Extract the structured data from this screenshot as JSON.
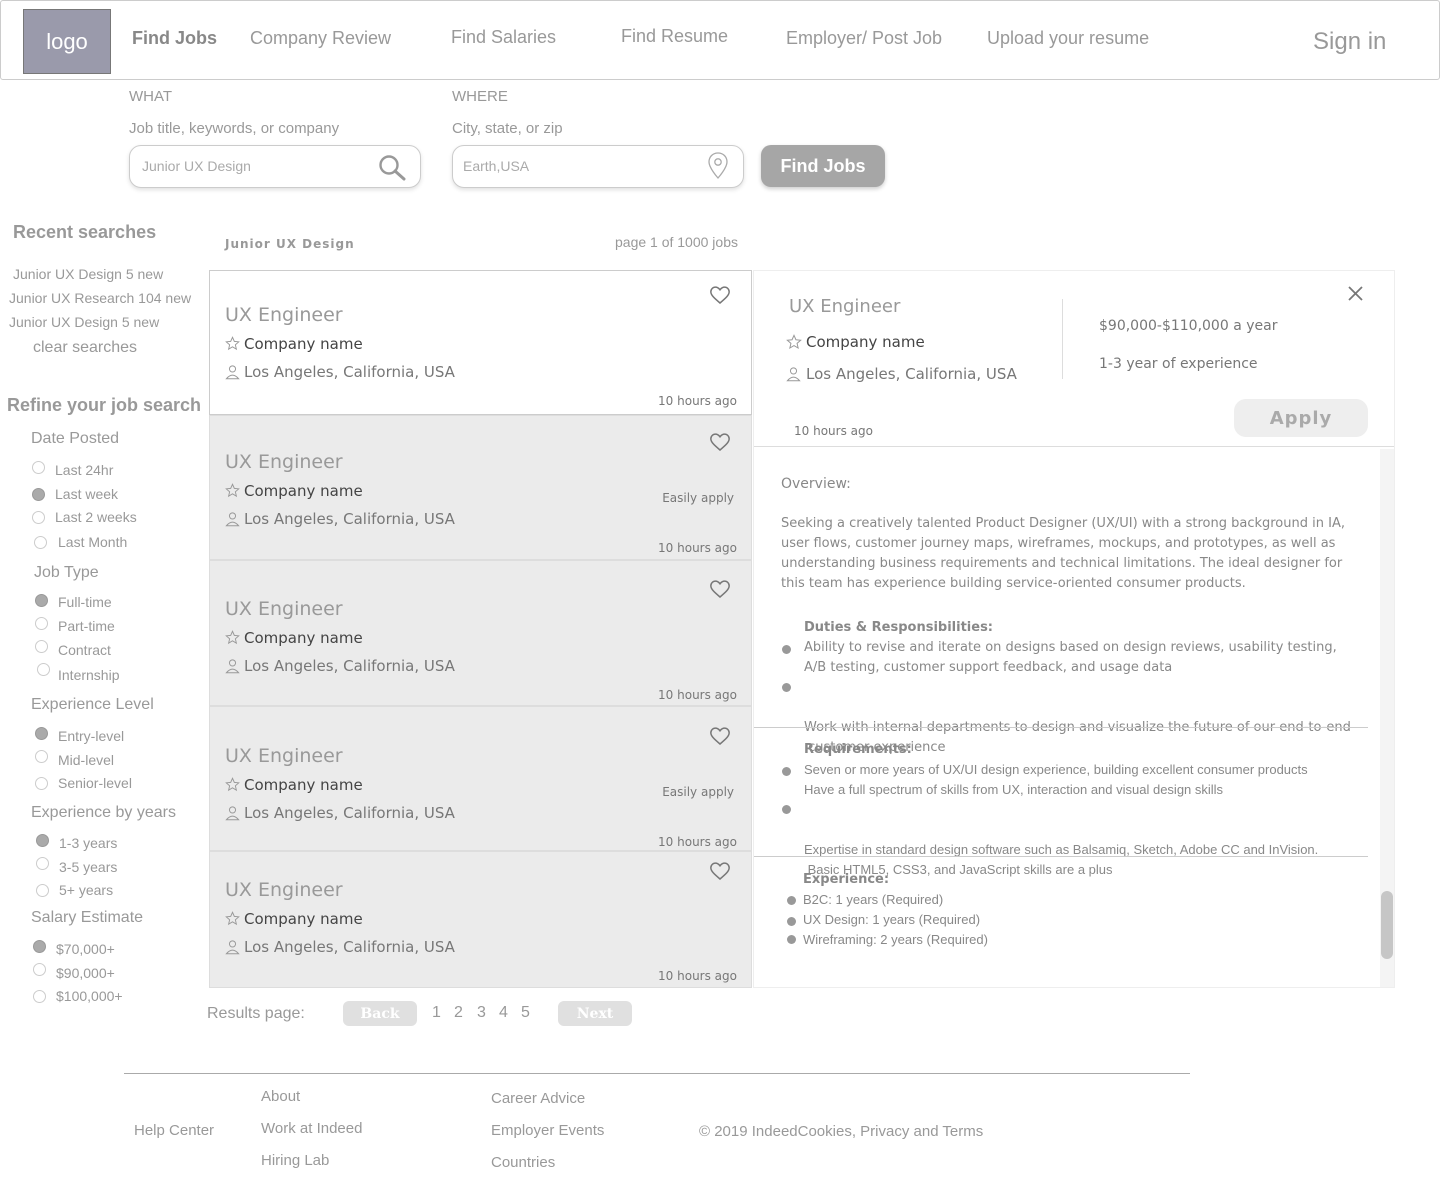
{
  "header": {
    "logo": "logo",
    "nav": [
      "Find Jobs",
      "Company Review",
      "Find Salaries",
      "Find Resume",
      "Employer/ Post Job",
      "Upload your resume"
    ],
    "signin": "Sign in"
  },
  "search": {
    "what_label": "WHAT",
    "what_hint": "Job title, keywords, or company",
    "what_placeholder": "Junior UX Design",
    "where_label": "WHERE",
    "where_hint": "City, state, or zip",
    "where_placeholder": "Earth,USA",
    "button": "Find Jobs"
  },
  "recent": {
    "title": "Recent searches",
    "items": [
      "Junior UX Design  5 new",
      "Junior UX Research 104 new",
      "Junior UX Design  5 new"
    ],
    "clear": "clear searches"
  },
  "refine": {
    "title": "Refine your job search",
    "groups": [
      {
        "label": "Date Posted",
        "options": [
          "Last 24hr",
          "Last week",
          "Last 2 weeks",
          "Last Month"
        ]
      },
      {
        "label": "Job Type",
        "options": [
          "Full-time",
          "Part-time",
          "Contract",
          "Internship"
        ]
      },
      {
        "label": "Experience Level",
        "options": [
          "Entry-level",
          "Mid-level",
          "Senior-level"
        ]
      },
      {
        "label": "Experience by years",
        "options": [
          "1-3 years",
          "3-5 years",
          "5+ years"
        ]
      },
      {
        "label": "Salary Estimate",
        "options": [
          "$70,000+",
          "$90,000+",
          "$100,000+"
        ]
      }
    ]
  },
  "results": {
    "query": "Junior UX Design",
    "page_info": "page 1 of 1000 jobs",
    "jobs": [
      {
        "title": "UX Engineer",
        "company": "Company name",
        "location": "Los Angeles, California, USA",
        "time": "10 hours ago",
        "badge": ""
      },
      {
        "title": "UX Engineer",
        "company": "Company name",
        "location": "Los Angeles, California, USA",
        "time": "10 hours ago",
        "badge": "Easily apply"
      },
      {
        "title": "UX Engineer",
        "company": "Company name",
        "location": "Los Angeles, California, USA",
        "time": "10 hours ago",
        "badge": ""
      },
      {
        "title": "UX Engineer",
        "company": "Company name",
        "location": "Los Angeles, California, USA",
        "time": "10 hours ago",
        "badge": "Easily apply"
      },
      {
        "title": "UX Engineer",
        "company": "Company name",
        "location": "Los Angeles, California, USA",
        "time": "10 hours ago",
        "badge": ""
      }
    ]
  },
  "detail": {
    "title": "UX Engineer",
    "company": "Company name",
    "location": "Los Angeles, California, USA",
    "salary": "$90,000-$110,000 a year",
    "experience": "1-3 year of experience",
    "time": "10 hours ago",
    "apply": "Apply",
    "overview_label": "Overview:",
    "overview_lines": [
      "Seeking a creatively talented Product Designer (UX/UI) with a strong background in IA,",
      "user flows, customer journey maps, wireframes, mockups, and prototypes, as well as",
      "understanding business requirements and technical limitations. The ideal designer for",
      "this team has experience building service-oriented consumer products."
    ],
    "duties_label": "Duties & Responsibilities:",
    "duties": [
      [
        "Ability to revise and iterate on designs based on design reviews, usability testing,",
        "A/B testing, customer support feedback, and usage data"
      ],
      [
        "Work with internal departments to design and visualize the future of our end-to-end",
        " customer experience"
      ]
    ],
    "requirements_label": "Requirements:",
    "requirements": [
      [
        "Seven or more years of UX/UI design experience,  building excellent consumer products",
        "Have a full spectrum of skills from UX, interaction and visual design skills"
      ],
      [
        "Expertise in standard design software such as Balsamiq, Sketch, Adobe CC and InVision.",
        " Basic HTML5, CSS3, and JavaScript skills are a plus"
      ]
    ],
    "experience_label": "Experience:",
    "experience_items": [
      "B2C: 1  years (Required)",
      "UX Design: 1 years (Required)",
      "Wireframing: 2 years (Required)"
    ]
  },
  "pagination": {
    "label": "Results page:",
    "back": "Back",
    "pages": [
      "1",
      "2",
      "3",
      "4",
      "5"
    ],
    "next": "Next"
  },
  "footer": {
    "help": "Help Center",
    "col1": [
      "About",
      "Work at Indeed",
      "Hiring Lab"
    ],
    "col2": [
      "Career Advice",
      "Employer Events",
      "Countries"
    ],
    "copyright": "© 2019 IndeedCookies, Privacy and Terms"
  }
}
